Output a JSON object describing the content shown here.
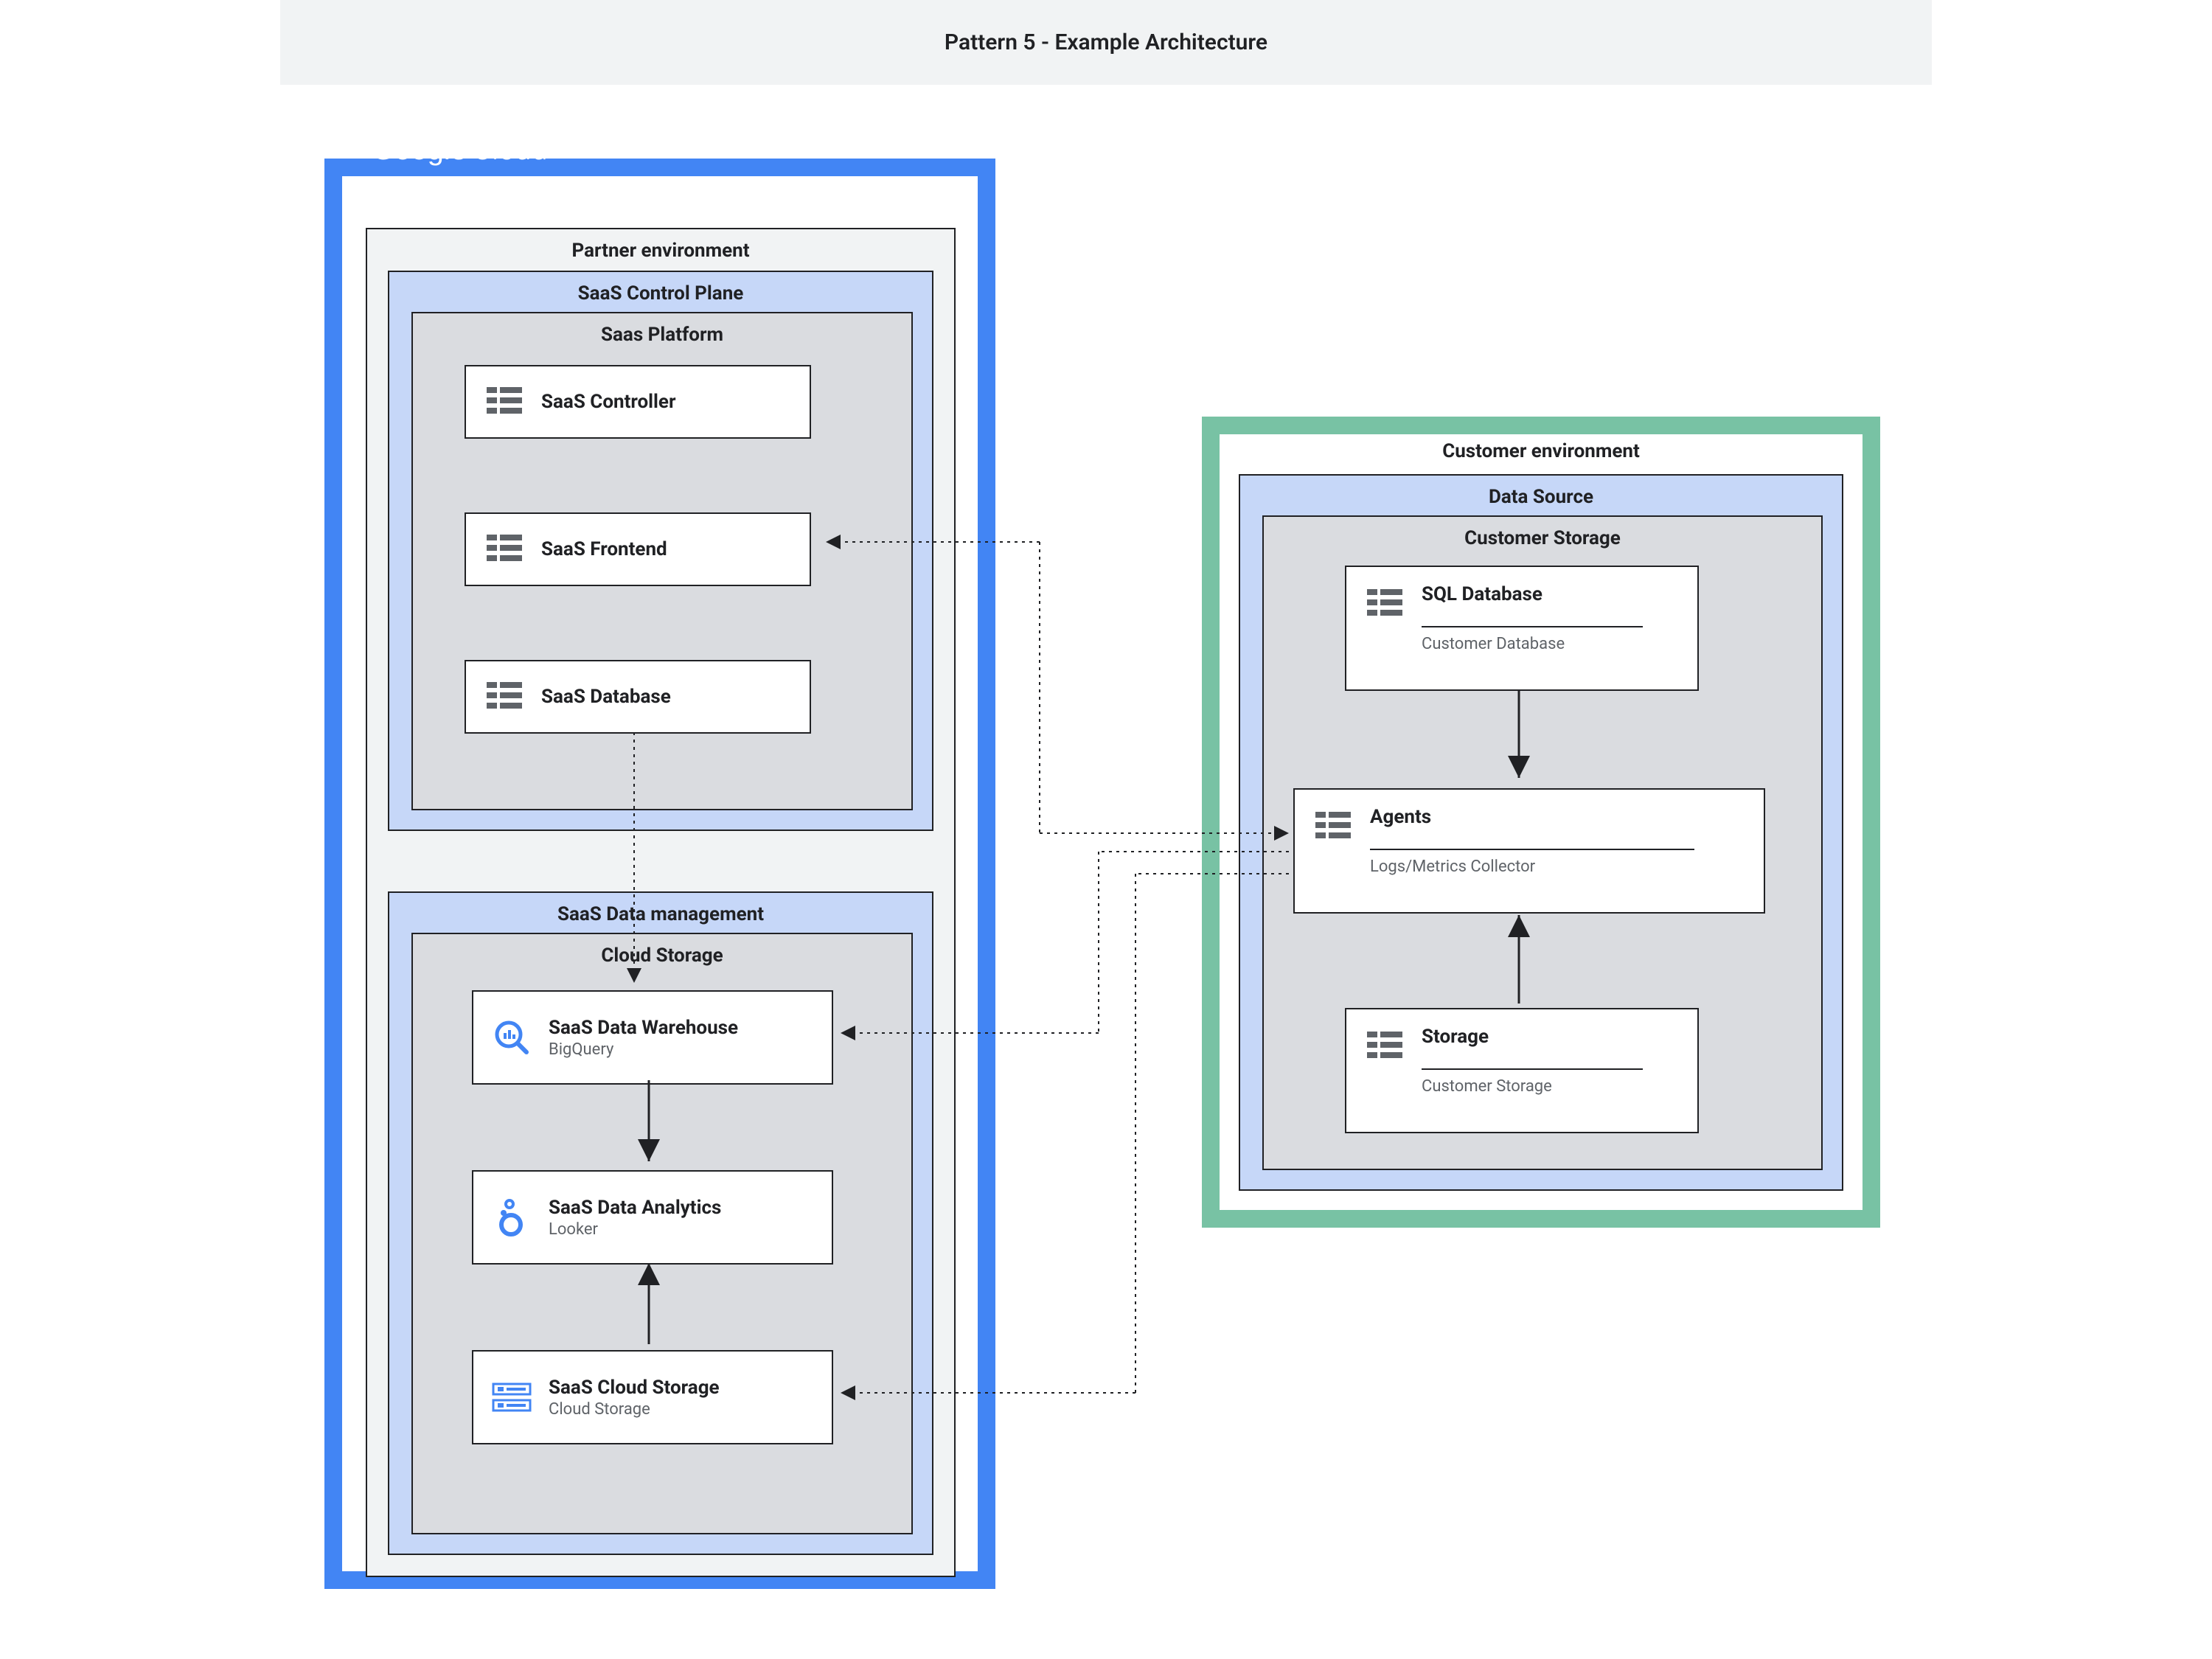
{
  "title": "Pattern 5 - Example Architecture",
  "gcp": {
    "brand": "Google Cloud",
    "partner_env": "Partner environment",
    "ctrl_plane": "SaaS Control Plane",
    "saas_platform": "Saas Platform",
    "cards": {
      "controller": "SaaS Controller",
      "frontend": "SaaS Frontend",
      "database": "SaaS Database"
    },
    "data_mgmt": "SaaS Data management",
    "cloud_storage": "Cloud Storage",
    "dm_cards": {
      "warehouse": {
        "title": "SaaS Data Warehouse",
        "sub": "BigQuery"
      },
      "analytics": {
        "title": "SaaS Data Analytics",
        "sub": "Looker"
      },
      "storage": {
        "title": "SaaS Cloud Storage",
        "sub": "Cloud Storage"
      }
    }
  },
  "customer": {
    "env": "Customer environment",
    "data_source": "Data Source",
    "cust_storage": "Customer Storage",
    "cards": {
      "sql": {
        "title": "SQL Database",
        "sub": "Customer Database"
      },
      "agents": {
        "title": "Agents",
        "sub": "Logs/Metrics Collector"
      },
      "storage": {
        "title": "Storage",
        "sub": "Customer Storage"
      }
    }
  }
}
